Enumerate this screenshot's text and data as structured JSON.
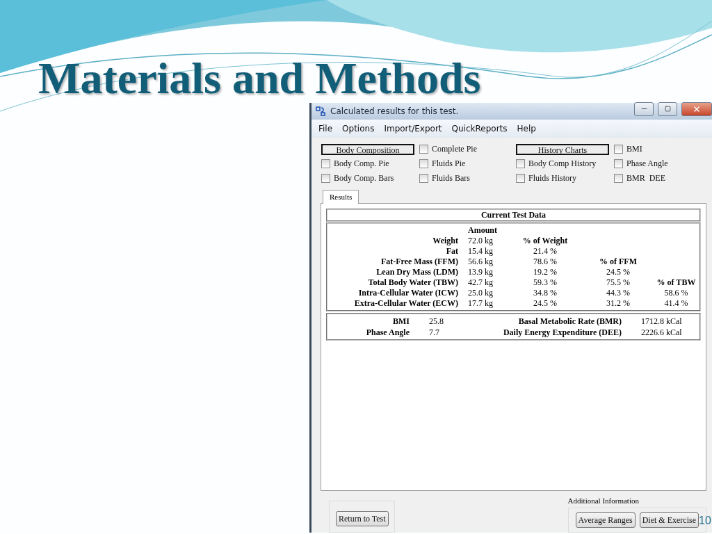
{
  "slide": {
    "title": "Materials and Methods",
    "page_number": "10"
  },
  "window": {
    "title": "Calculated results for this test."
  },
  "menu": [
    "File",
    "Options",
    "Import/Export",
    "QuickReports",
    "Help"
  ],
  "options": [
    {
      "kind": "button",
      "label": "Body Composition"
    },
    {
      "kind": "checkbox",
      "label": "Complete Pie",
      "checked": false
    },
    {
      "kind": "button",
      "label": "History Charts"
    },
    {
      "kind": "checkbox",
      "label": "BMI",
      "checked": false
    },
    {
      "kind": "checkbox",
      "label": "Body Comp. Pie",
      "checked": false
    },
    {
      "kind": "checkbox",
      "label": "Fluids Pie",
      "checked": false
    },
    {
      "kind": "checkbox",
      "label": "Body Comp History",
      "checked": false
    },
    {
      "kind": "checkbox",
      "label": "Phase Angle",
      "checked": false
    },
    {
      "kind": "checkbox",
      "label": "Body Comp. Bars",
      "checked": false
    },
    {
      "kind": "checkbox",
      "label": "Fluids Bars",
      "checked": false
    },
    {
      "kind": "checkbox",
      "label": "Fluids History",
      "checked": false
    },
    {
      "kind": "checkbox",
      "label": "BMR  DEE",
      "checked": false
    }
  ],
  "tabs": [
    {
      "label": "Results",
      "selected": true
    }
  ],
  "results": {
    "heading": "Current Test Data",
    "rows": [
      {
        "amount": "Amount"
      },
      {
        "label": "Weight",
        "amount": "72.0 kg",
        "pct_weight": "% of Weight"
      },
      {
        "label": "Fat",
        "amount": "15.4 kg",
        "pct_weight": "21.4 %"
      },
      {
        "label": "Fat-Free Mass (FFM)",
        "amount": "56.6 kg",
        "pct_weight": "78.6 %",
        "pct_ffm": "% of FFM"
      },
      {
        "label": "Lean Dry Mass (LDM)",
        "amount": "13.9 kg",
        "pct_weight": "19.2 %",
        "pct_ffm": "24.5 %"
      },
      {
        "label": "Total Body Water (TBW)",
        "amount": "42.7 kg",
        "pct_weight": "59.3 %",
        "pct_ffm": "75.5 %",
        "pct_tbw": "% of TBW"
      },
      {
        "label": "Intra-Cellular Water (ICW)",
        "amount": "25.0 kg",
        "pct_weight": "34.8 %",
        "pct_ffm": "44.3 %",
        "pct_tbw": "58.6 %"
      },
      {
        "label": "Extra-Cellular Water (ECW)",
        "amount": "17.7 kg",
        "pct_weight": "24.5 %",
        "pct_ffm": "31.2 %",
        "pct_tbw": "41.4 %"
      }
    ],
    "summary": [
      {
        "label": "BMI",
        "value": "25.8",
        "label_2": "Basal Metabolic Rate (BMR)",
        "value_2": "1712.8 kCal"
      },
      {
        "label": "Phase Angle",
        "value": "7.7",
        "label_2": "Daily Energy Expenditure (DEE)",
        "value_2": "2226.6 kCal"
      }
    ]
  },
  "return_button": "Return to Test",
  "additional": {
    "legend": "Additional Information",
    "buttons": [
      "Average Ranges",
      "Diet & Exercise"
    ]
  }
}
